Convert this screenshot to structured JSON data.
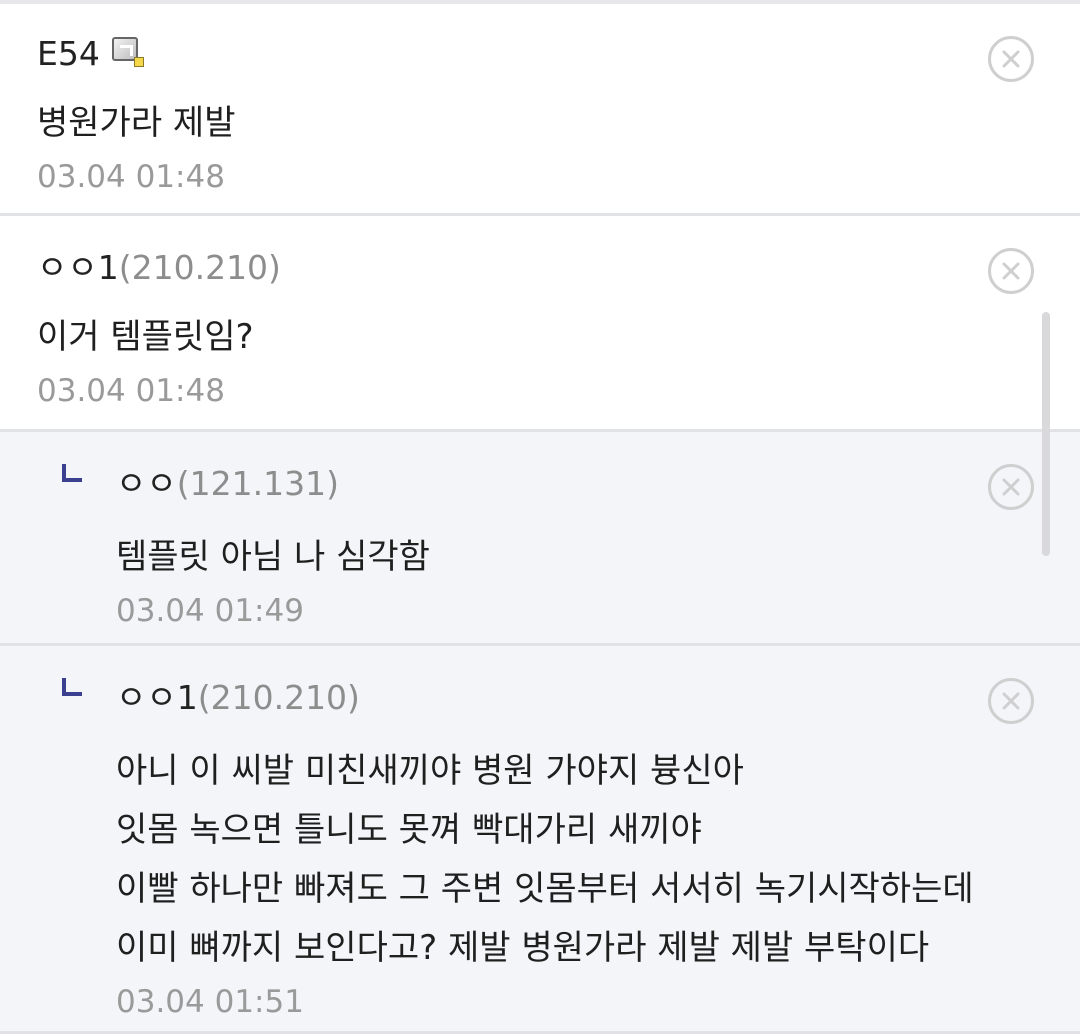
{
  "comments": [
    {
      "nick": "E54",
      "ip": "",
      "lines": [
        "병원가라 제발"
      ],
      "time": "03.04 01:48",
      "is_reply": false,
      "has_gallog_icon": true
    },
    {
      "nick": "ㅇㅇ1",
      "ip": "(210.210)",
      "lines": [
        "이거 템플릿임?"
      ],
      "time": "03.04 01:48",
      "is_reply": false
    },
    {
      "nick": "ㅇㅇ",
      "ip": "(121.131)",
      "lines": [
        "템플릿 아님 나 심각함"
      ],
      "time": "03.04 01:49",
      "is_reply": true
    },
    {
      "nick": "ㅇㅇ1",
      "ip": "(210.210)",
      "lines": [
        "아니 이 씨발 미친새끼야 병원 가야지 븅신아",
        "잇몸 녹으면 틀니도 못껴 빡대가리 새끼야",
        "이빨 하나만 빠져도 그 주변 잇몸부터 서서히 녹기시작하는데",
        "이미 뼈까지 보인다고? 제발 병원가라 제발 제발 부탁이다"
      ],
      "time": "03.04 01:51",
      "is_reply": true
    }
  ],
  "icons": {
    "delete": "circle-x-icon",
    "reply": "reply-arrow-icon",
    "gallog": "gallog-icon"
  },
  "colors": {
    "reply_background": "#f4f5f9",
    "reply_arrow": "#3a3f8f",
    "meta_text": "#9a9a9a",
    "divider": "#e1e2e6"
  }
}
